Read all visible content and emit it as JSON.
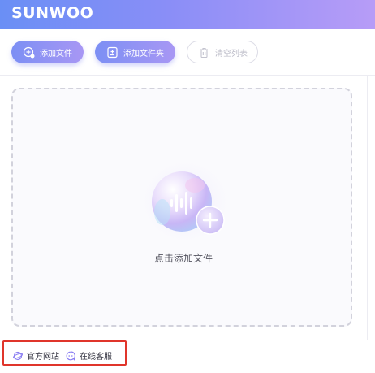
{
  "app": {
    "logo_text": "SUNWOO"
  },
  "toolbar": {
    "add_file_label": "添加文件",
    "add_folder_label": "添加文件夹",
    "clear_list_label": "清空列表"
  },
  "drop_zone": {
    "prompt": "点击添加文件"
  },
  "footer": {
    "official_site_label": "官方网站",
    "online_service_label": "在线客服"
  },
  "colors": {
    "accent_start": "#7c8ff4",
    "accent_end": "#a897f4",
    "highlight": "#e0352b"
  },
  "icons": {
    "add_file": "add-file-icon",
    "add_folder": "add-folder-icon",
    "clear_list": "trash-icon",
    "official_site": "globe-icon",
    "online_service": "chat-icon",
    "drop_zone": "audio-wave-plus-icon"
  }
}
